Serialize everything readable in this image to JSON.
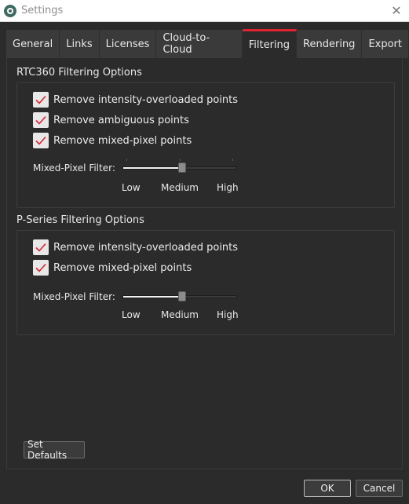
{
  "window": {
    "title": "Settings",
    "close_glyph": "✕"
  },
  "icons": {
    "app": "app-logo-icon",
    "close": "close-icon",
    "check": "checkmark-icon"
  },
  "colors": {
    "accent": "#e0222f",
    "background": "#2b2b2b",
    "tab_background": "#3a3a3a"
  },
  "tabs": [
    {
      "label": "General",
      "active": false
    },
    {
      "label": "Links",
      "active": false
    },
    {
      "label": "Licenses",
      "active": false
    },
    {
      "label": "Cloud-to-Cloud",
      "active": false
    },
    {
      "label": "Filtering",
      "active": true
    },
    {
      "label": "Rendering",
      "active": false
    },
    {
      "label": "Export",
      "active": false
    }
  ],
  "rtc360": {
    "title": "RTC360 Filtering Options",
    "options": [
      {
        "label": "Remove intensity-overloaded points",
        "checked": true
      },
      {
        "label": "Remove ambiguous points",
        "checked": true
      },
      {
        "label": "Remove mixed-pixel points",
        "checked": true
      }
    ],
    "slider": {
      "label": "Mixed-Pixel Filter:",
      "level": 0.5,
      "ticks": [
        "Low",
        "Medium",
        "High"
      ]
    }
  },
  "pseries": {
    "title": "P-Series Filtering Options",
    "options": [
      {
        "label": "Remove intensity-overloaded points",
        "checked": true
      },
      {
        "label": "Remove mixed-pixel points",
        "checked": true
      }
    ],
    "slider": {
      "label": "Mixed-Pixel Filter:",
      "level": 0.5,
      "ticks": [
        "Low",
        "Medium",
        "High"
      ]
    }
  },
  "buttons": {
    "set_defaults": "Set Defaults",
    "ok": "OK",
    "cancel": "Cancel"
  }
}
